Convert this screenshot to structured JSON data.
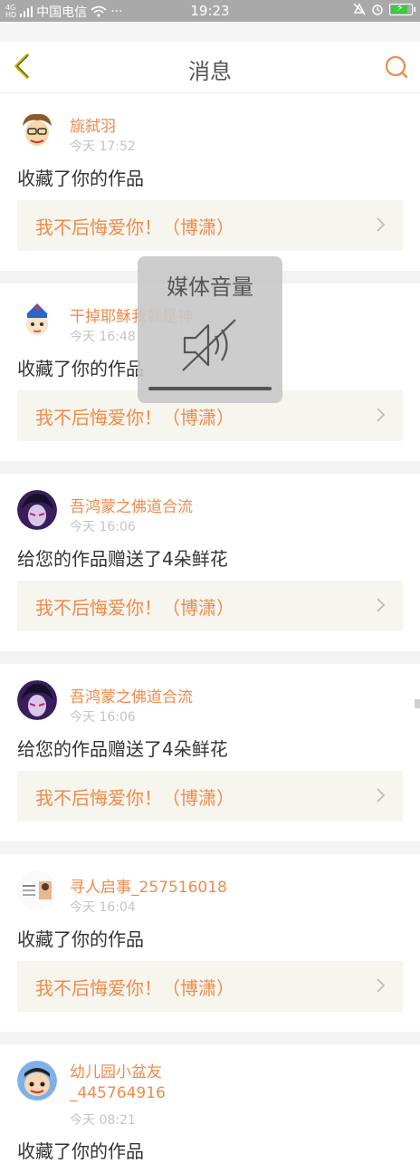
{
  "status_bar": {
    "signal_tag": "4G\nHD",
    "carrier": "中国电信",
    "more": "···",
    "time": "19:23",
    "icons": [
      "signal-icon",
      "wifi-icon",
      "mute-icon",
      "alarm-icon",
      "battery-charging-icon"
    ]
  },
  "header": {
    "title": "消息",
    "back_icon": "chevron-left-icon",
    "search_icon": "search-icon"
  },
  "feed": [
    {
      "user": "旐弑羽",
      "time": "今天 17:52",
      "action": "收藏了你的作品",
      "work": "我不后悔爱你！（博潇）"
    },
    {
      "user": "干掉耶稣我就是神",
      "time": "今天 16:48",
      "action": "收藏了你的作品",
      "work": "我不后悔爱你！（博潇）"
    },
    {
      "user": "吾鸿蒙之佛道合流",
      "time": "今天 16:06",
      "action": "给您的作品赠送了4朵鲜花",
      "work": "我不后悔爱你！（博潇）"
    },
    {
      "user": "吾鸿蒙之佛道合流",
      "time": "今天 16:06",
      "action": "给您的作品赠送了4朵鲜花",
      "work": "我不后悔爱你！（博潇）"
    },
    {
      "user": "寻人启事_257516018",
      "time": "今天 16:04",
      "action": "收藏了你的作品",
      "work": "我不后悔爱你！（博潇）"
    },
    {
      "user": "幼儿园小盆友\n_445764916",
      "time": "今天 08:21",
      "action": "收藏了你的作品",
      "work": ""
    }
  ],
  "overlay": {
    "title": "媒体音量",
    "icon": "speaker-muted-icon",
    "level": 0
  },
  "colors": {
    "accent": "#f08a4b",
    "work_bg": "#f6f6ee",
    "status_bar_bg": "#a9a9a9",
    "back_icon": "#c8b400"
  }
}
